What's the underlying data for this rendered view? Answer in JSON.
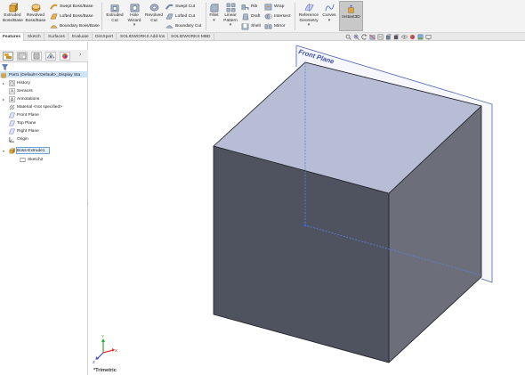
{
  "ribbon": {
    "extruded_boss": "Extruded Boss/Base",
    "revolved_boss": "Revolved Boss/Base",
    "swept_boss": "Swept Boss/Base",
    "lofted_boss": "Lofted Boss/Base",
    "boundary_boss": "Boundary Boss/Base",
    "extruded_cut": "Extruded Cut",
    "hole_wizard": "Hole Wizard",
    "revolved_cut": "Revolved Cut",
    "swept_cut": "Swept Cut",
    "lofted_cut": "Lofted Cut",
    "boundary_cut": "Boundary Cut",
    "fillet": "Fillet",
    "linear_pattern": "Linear Pattern",
    "rib": "Rib",
    "draft": "Draft",
    "shell": "Shell",
    "wrap": "Wrap",
    "intersect": "Intersect",
    "mirror": "Mirror",
    "reference_geometry": "Reference Geometry",
    "curves": "Curves",
    "instant3d": "Instant3D"
  },
  "tabs": [
    "Features",
    "Sketch",
    "Surfaces",
    "Evaluate",
    "DimXpert",
    "SOLIDWORKS Add-Ins",
    "SOLIDWORKS MBD"
  ],
  "tree": {
    "root": "Part1  (Default<<Default>_Display Sta",
    "items": [
      "History",
      "Sensors",
      "Annotations",
      "Material <not specified>",
      "Front Plane",
      "Top Plane",
      "Right Plane",
      "Origin",
      "Boss-Extrude1",
      "Sketch2"
    ]
  },
  "viewport": {
    "plane_label": "Front Plane",
    "view_name": "*Trimetric",
    "triad": {
      "x": "X",
      "y": "Y",
      "z": "Z"
    }
  },
  "colors": {
    "cube_top": "#b6bdd4",
    "cube_front": "#4f525f",
    "cube_right": "#6c6f7a",
    "plane_border": "#4d62b8",
    "selection": "#cfe3f7",
    "instant3d_bg": "#c8c8c8"
  }
}
